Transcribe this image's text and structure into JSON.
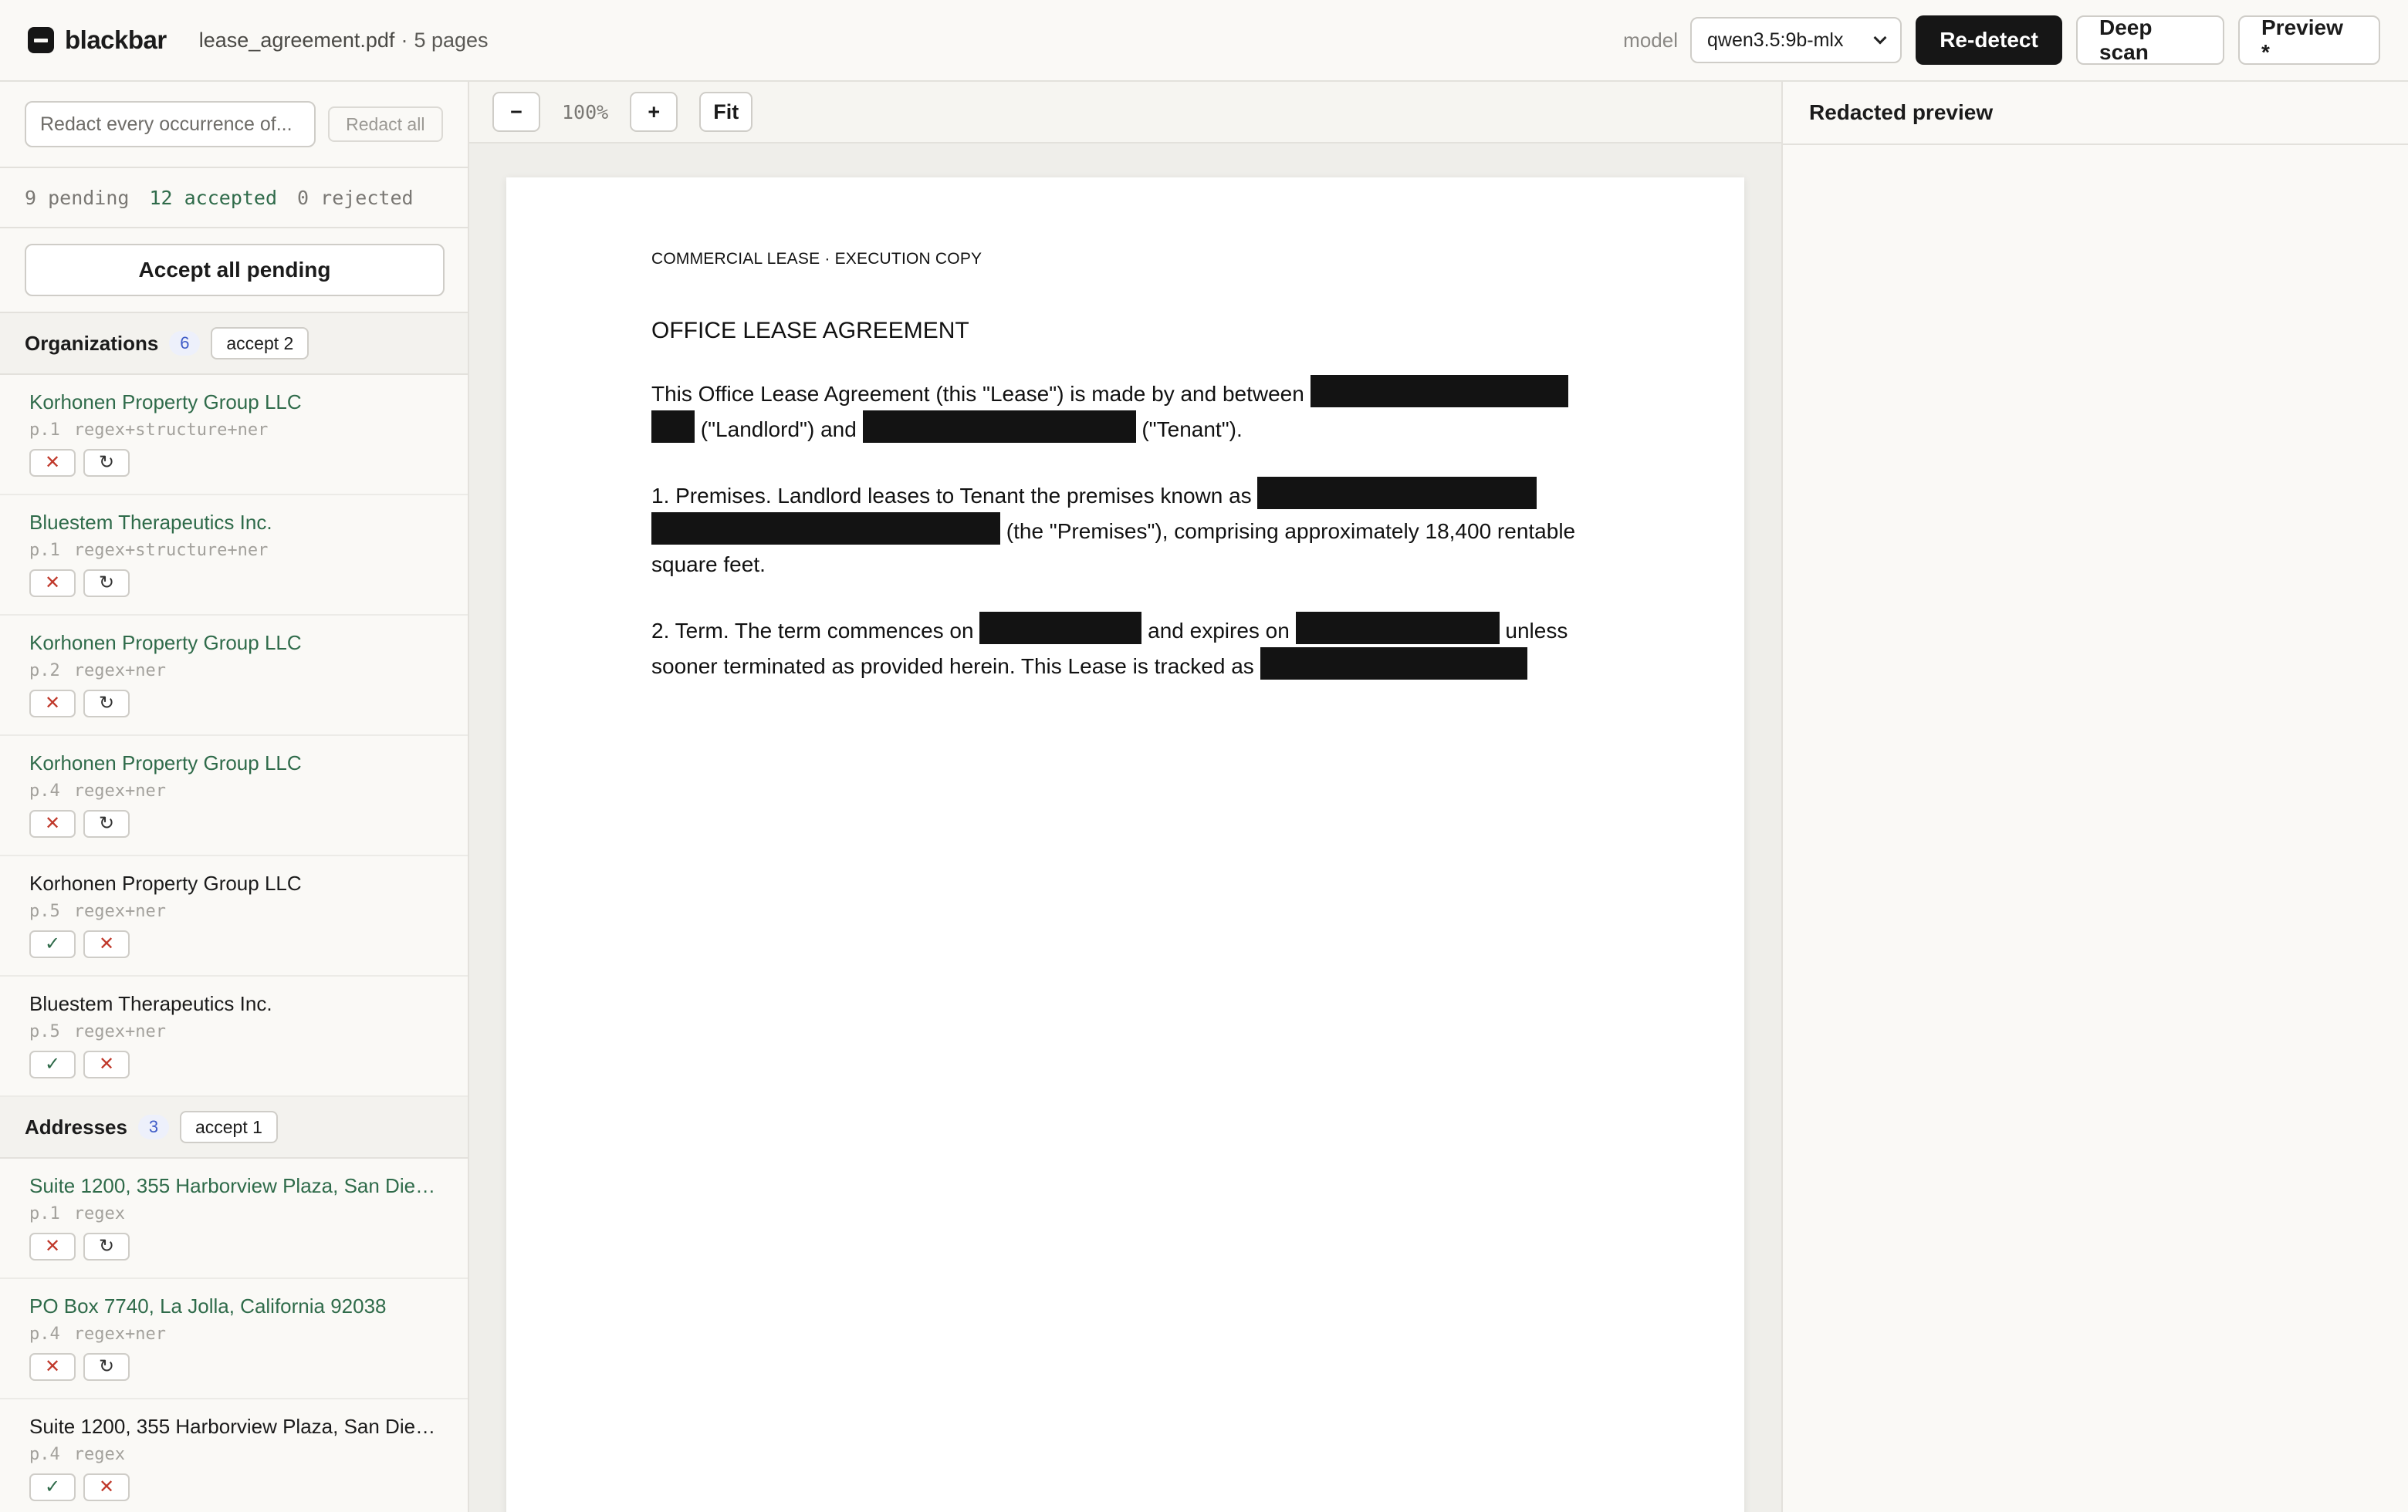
{
  "app": {
    "name": "blackbar"
  },
  "file": {
    "name": "lease_agreement.pdf",
    "separator": "·",
    "pages": "5 pages"
  },
  "toolbar": {
    "model_label": "model",
    "model_value": "qwen3.5:9b-mlx",
    "redetect_label": "Re-detect",
    "deep_scan_label": "Deep scan",
    "preview_label": "Preview *"
  },
  "sidebar": {
    "redact_placeholder": "Redact every occurrence of...",
    "redact_all_label": "Redact all",
    "counts": {
      "pending": "9 pending",
      "accepted": "12 accepted",
      "rejected": "0 rejected"
    },
    "accept_all_label": "Accept all pending",
    "groups": [
      {
        "title": "Organizations",
        "count": "6",
        "accept_label": "accept 2",
        "items": [
          {
            "text": "Korhonen Property Group LLC",
            "page": "p.1",
            "source": "regex+structure+ner",
            "status": "accepted"
          },
          {
            "text": "Bluestem Therapeutics Inc.",
            "page": "p.1",
            "source": "regex+structure+ner",
            "status": "accepted"
          },
          {
            "text": "Korhonen Property Group LLC",
            "page": "p.2",
            "source": "regex+ner",
            "status": "accepted"
          },
          {
            "text": "Korhonen Property Group LLC",
            "page": "p.4",
            "source": "regex+ner",
            "status": "accepted"
          },
          {
            "text": "Korhonen Property Group LLC",
            "page": "p.5",
            "source": "regex+ner",
            "status": "pending"
          },
          {
            "text": "Bluestem Therapeutics Inc.",
            "page": "p.5",
            "source": "regex+ner",
            "status": "pending"
          }
        ]
      },
      {
        "title": "Addresses",
        "count": "3",
        "accept_label": "accept 1",
        "items": [
          {
            "text": "Suite 1200, 355 Harborview Plaza, San Dieg...",
            "page": "p.1",
            "source": "regex",
            "status": "accepted"
          },
          {
            "text": "PO Box 7740, La Jolla, California 92038",
            "page": "p.4",
            "source": "regex+ner",
            "status": "accepted"
          },
          {
            "text": "Suite 1200, 355 Harborview Plaza, San Dieg...",
            "page": "p.4",
            "source": "regex",
            "status": "pending"
          }
        ]
      }
    ]
  },
  "viewer": {
    "zoom_out": "−",
    "zoom_level": "100%",
    "zoom_in": "+",
    "fit": "Fit",
    "doc": {
      "header": "COMMERCIAL LEASE · EXECUTION COPY",
      "title": "OFFICE LEASE AGREEMENT",
      "p1a": "This Office Lease Agreement (this \"Lease\") is made by and between",
      "p1b": "(\"Landlord\") and",
      "p1c": "(\"Tenant\").",
      "p2a": "1. Premises. Landlord leases to Tenant the premises known as",
      "p2b": "(the \"Premises\"), comprising approximately 18,400 rentable square feet.",
      "p3a": "2. Term. The term commences on",
      "p3b": "and expires on",
      "p3c": "unless sooner terminated as provided herein. This Lease is tracked as"
    }
  },
  "preview": {
    "title": "Redacted preview"
  },
  "colors": {
    "accepted": "#2f6b4a",
    "reject": "#c0392b",
    "dark": "#161616",
    "count_badge": "#3f5cc7"
  }
}
